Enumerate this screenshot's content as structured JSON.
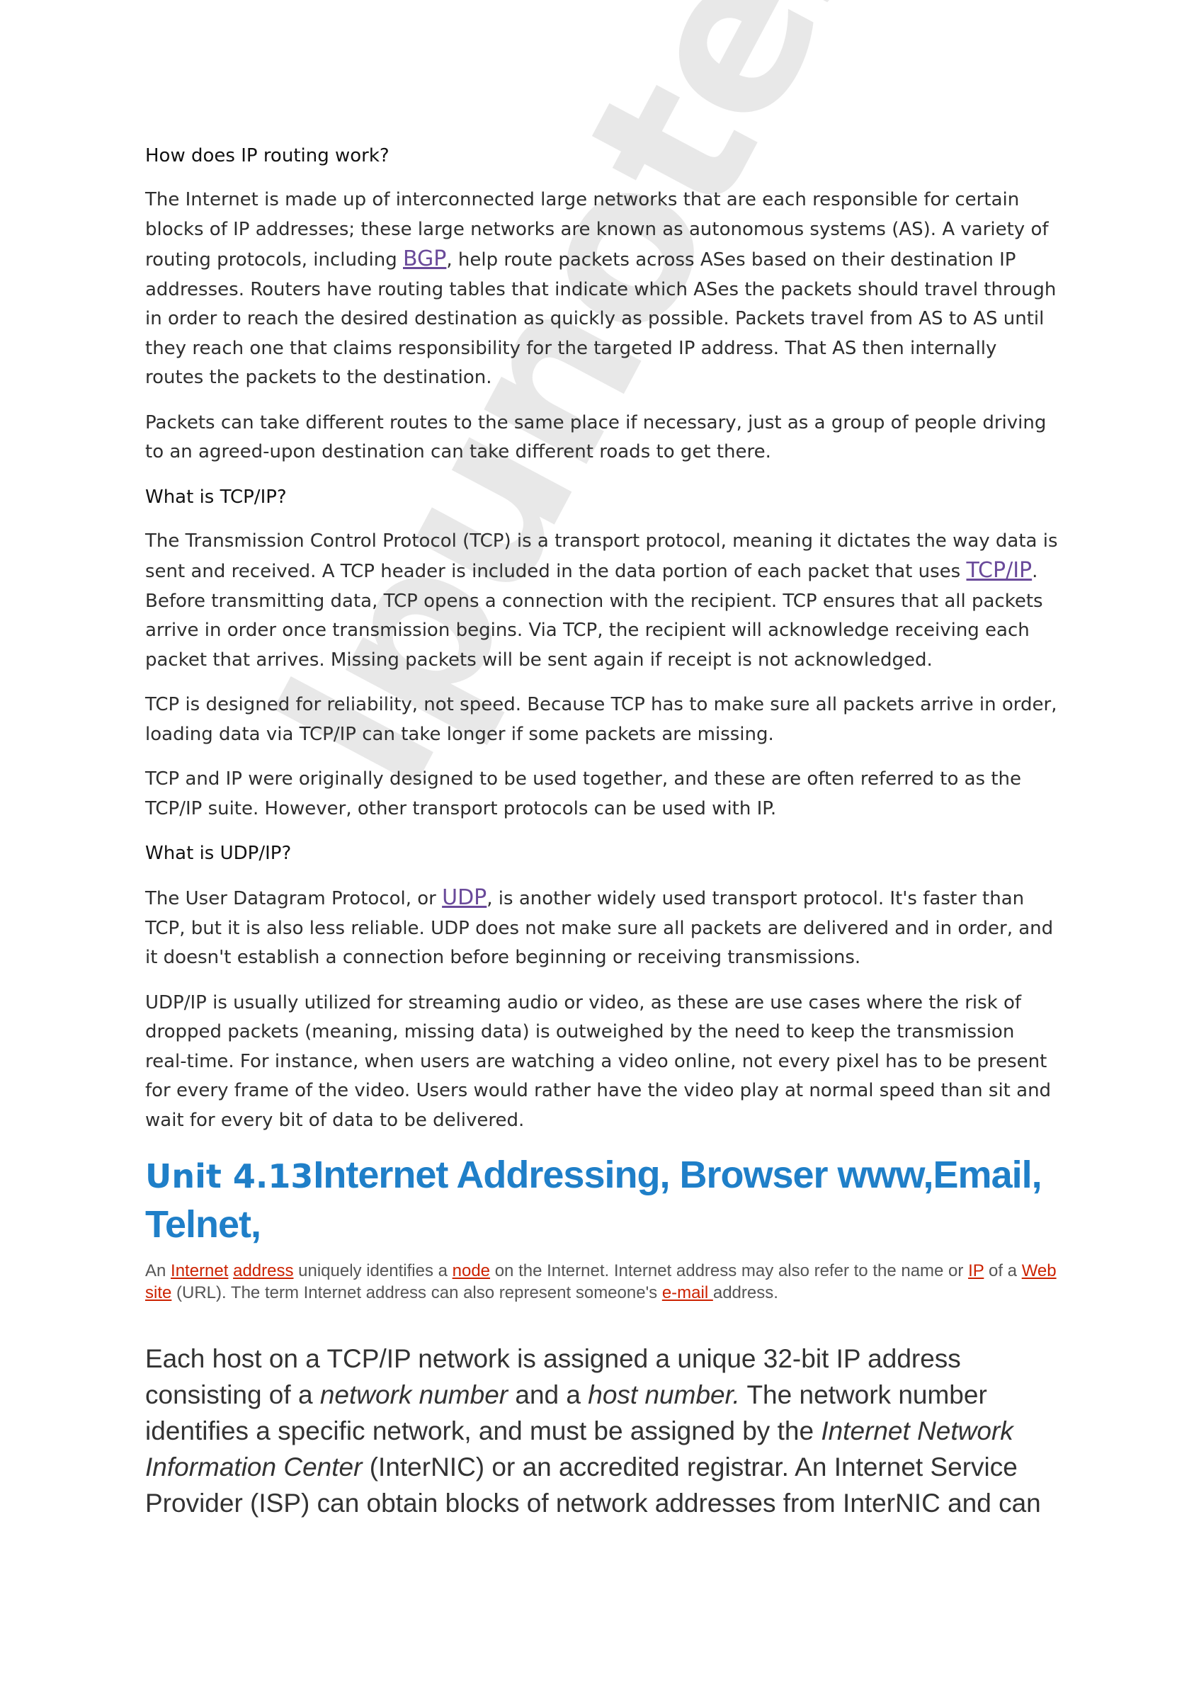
{
  "watermark": "lpunotes",
  "routing": {
    "heading": "How does IP routing work?",
    "p1": {
      "a": "The Internet is made up of interconnected large networks that are each responsible for certain blocks of IP addresses; these large networks are known as autonomous systems (AS). A variety of routing protocols, including ",
      "link": "BGP",
      "b": ", help route packets across ASes based on their destination IP addresses. Routers have routing tables that indicate which ASes the packets should travel through in order to reach the desired destination as quickly as possible. Packets travel from AS to AS until they reach one that claims responsibility for the targeted IP address. That AS then internally routes the packets to the destination."
    },
    "p2": "Packets can take different routes to the same place if necessary, just as a group of people driving to an agreed-upon destination can take different roads to get there."
  },
  "tcp": {
    "heading": "What is TCP/IP?",
    "p1": {
      "a": "The Transmission Control Protocol (TCP) is a transport protocol, meaning it dictates the way data is sent and received. A TCP header is included in the data portion of each packet that uses ",
      "link": "TCP/IP",
      "b": ". Before transmitting data, TCP opens a connection with the recipient. TCP ensures that all packets arrive in order once transmission begins. Via TCP, the recipient will acknowledge receiving each packet that arrives. Missing packets will be sent again if receipt is not acknowledged."
    },
    "p2": "TCP is designed for reliability, not speed. Because TCP has to make sure all packets arrive in order, loading data via TCP/IP can take longer if some packets are missing.",
    "p3": "TCP and IP were originally designed to be used together, and these are often referred to as the TCP/IP suite. However, other transport protocols can be used with IP."
  },
  "udp": {
    "heading": "What is UDP/IP?",
    "p1": {
      "a": "The User Datagram Protocol, or ",
      "link": "UDP",
      "b": ", is another widely used transport protocol. It's faster than TCP, but it is also less reliable. UDP does not make sure all packets are delivered and in order, and it doesn't establish a connection before beginning or receiving transmissions."
    },
    "p2": "UDP/IP is usually utilized for streaming audio or video, as these are use cases where the risk of dropped packets (meaning, missing data) is outweighed by the need to keep the transmission real-time. For instance, when users are watching a video online, not every pixel has to be present for every frame of the video. Users would rather have the video play at normal speed than sit and wait for every bit of data to be delivered."
  },
  "unit": {
    "number": "Unit 4.13",
    "title": "Internet Addressing, Browser www,Email, Telnet,"
  },
  "definition": {
    "t1": "An ",
    "internet": "Internet",
    "address": "address",
    "t2": " uniquely identifies a ",
    "node": "node",
    "t3": " on the Internet.  Internet address may also refer to the name or ",
    "ip": "IP",
    "t4": " of a ",
    "website": "Web site",
    "t5": " (URL). The term Internet address can also represent someone's ",
    "email": "e-mail ",
    "t6": "address."
  },
  "host": {
    "t1": "Each host on a TCP/IP network is assigned a unique 32-bit IP address consisting of a ",
    "i1": "network number",
    "t2": " and a ",
    "i2": "host number.",
    "t3": " The network number identifies a specific network, and must be assigned by the ",
    "i3": "Internet Network Information Center",
    "t4": " (InterNIC) or an accredited registrar. An Internet Service Provider (ISP) can obtain blocks of network addresses from InterNIC and can"
  },
  "colors": {
    "link": "#6a4a9a",
    "heading_blue": "#1f7fc8",
    "definition_link": "#cc2200"
  }
}
